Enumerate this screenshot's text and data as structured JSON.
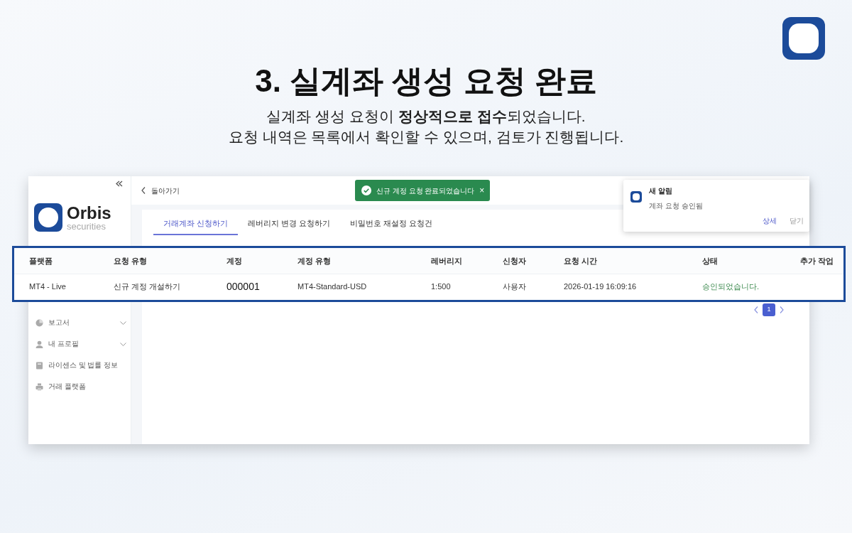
{
  "heading": {
    "title": "3. 실계좌 생성 요청 완료",
    "lines": [
      "실계좌 생성 요청이 **정상적으로 접수**되었습니다.",
      "요청 내역은 목록에서 확인할 수 있으며, 검토가 진행됩니다."
    ]
  },
  "sidebar": {
    "logo_name": "Orbis",
    "logo_sub": "securities",
    "items": [
      {
        "label": "보고서",
        "expandable": true
      },
      {
        "label": "내 프로필",
        "expandable": true
      },
      {
        "label": "라이센스 및 법률 정보",
        "expandable": false
      },
      {
        "label": "거래 플랫폼",
        "expandable": false
      }
    ]
  },
  "topbar": {
    "back": "돌아가기"
  },
  "toast": {
    "message": "신규 계정 요청 완료되었습니다",
    "close": "×"
  },
  "notification": {
    "title": "새 알림",
    "message": "계좌 요청 승인됨",
    "actions": [
      {
        "label": "상세",
        "primary": true
      },
      {
        "label": "닫기",
        "primary": false
      }
    ]
  },
  "tabs": [
    {
      "label": "거래계좌 신청하기",
      "selected": true
    },
    {
      "label": "레버리지 변경 요청하기",
      "selected": false
    },
    {
      "label": "비밀번호 재설정 요청건",
      "selected": false
    }
  ],
  "table": {
    "highlighted": true,
    "columns": [
      "플랫폼",
      "요청 유형",
      "계정",
      "계정 유형",
      "레버리지",
      "신청자",
      "요청 시간",
      "상태",
      "추가 작업"
    ],
    "rows": [
      {
        "cells": [
          "MT4 - Live",
          "신규 계정 개설하기",
          "000001",
          "MT4-Standard-USD",
          "1:500",
          "사용자",
          "2026-01-19 16:09:16",
          "승인되었습니다."
        ]
      }
    ]
  },
  "pagination": {
    "pages": [
      {
        "label": "1",
        "selected": true
      }
    ]
  }
}
